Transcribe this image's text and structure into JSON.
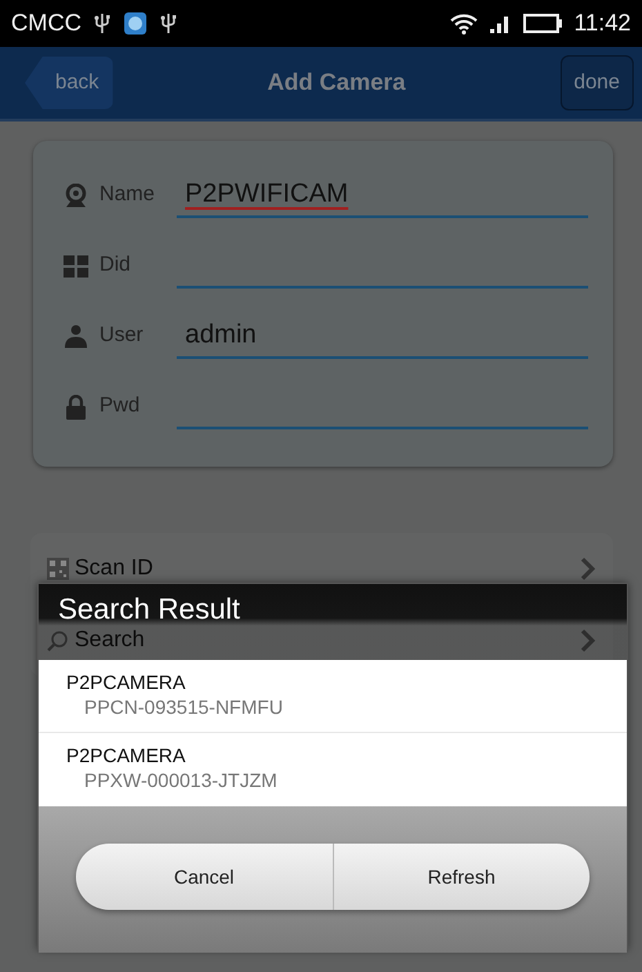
{
  "status_bar": {
    "carrier": "CMCC",
    "time": "11:42"
  },
  "nav_bar": {
    "back": "back",
    "title": "Add Camera",
    "done": "done"
  },
  "form": {
    "fields": [
      {
        "kind": "camera",
        "label": "Name",
        "value": "P2PWIFICAM",
        "spell_error": true
      },
      {
        "kind": "grid",
        "label": "Did"
      },
      {
        "kind": "user",
        "label": "User",
        "value": "admin",
        "spell_error": false
      },
      {
        "kind": "lock",
        "label": "Pwd"
      }
    ]
  },
  "actions": [
    {
      "kind": "qr",
      "label": "Scan ID"
    },
    {
      "kind": "search",
      "label": "Search"
    }
  ],
  "dialog": {
    "title": "Search Result",
    "results": [
      {
        "name": "P2PCAMERA",
        "id": "PPCN-093515-NFMFU"
      },
      {
        "name": "P2PCAMERA",
        "id": "PPXW-000013-JTJZM"
      }
    ],
    "buttons": [
      "Cancel",
      "Refresh"
    ]
  }
}
